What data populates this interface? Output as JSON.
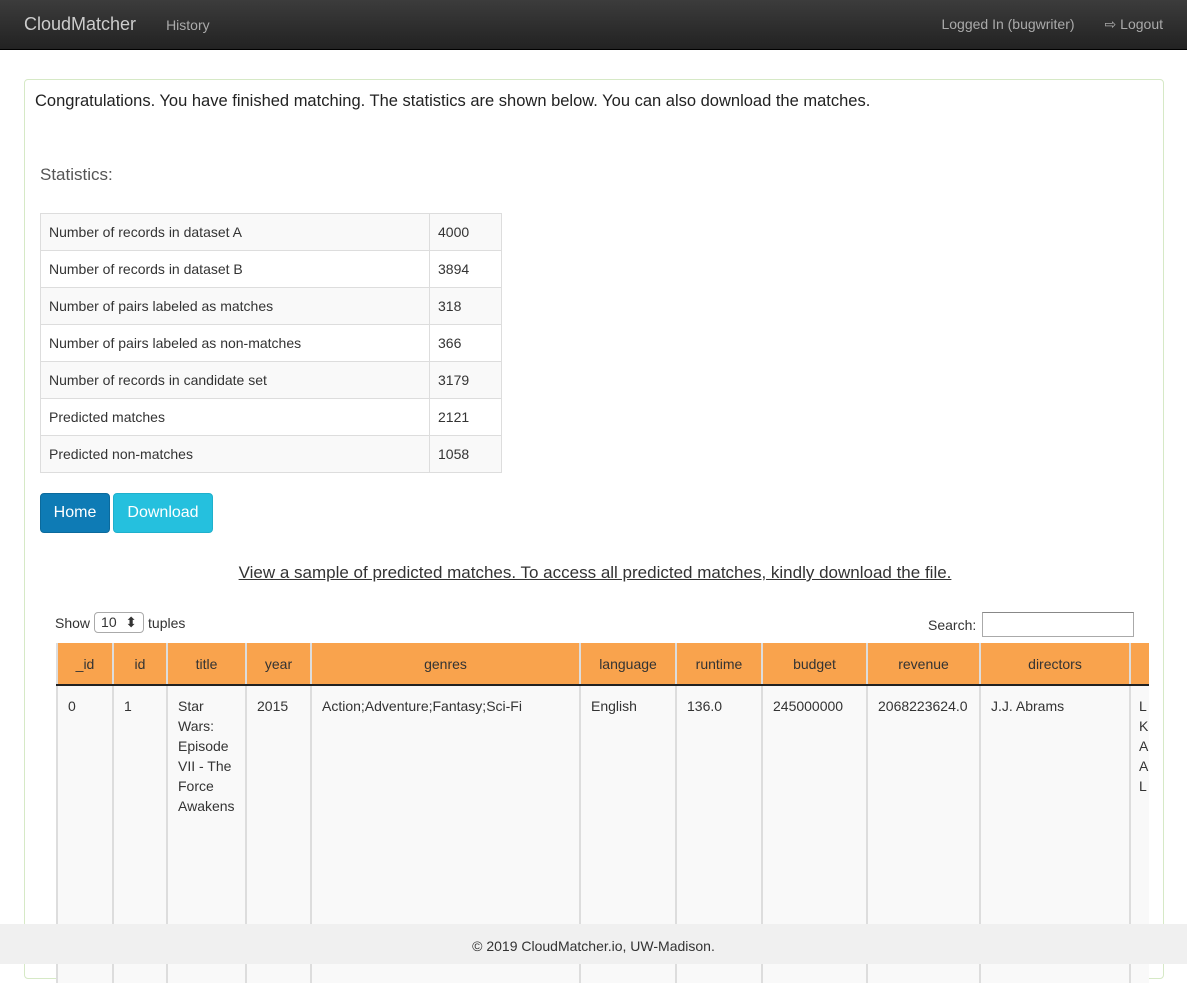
{
  "nav": {
    "brand": "CloudMatcher",
    "history": "History",
    "logged_in": "Logged In (bugwriter)",
    "logout": "Logout"
  },
  "message": "Congratulations. You have finished matching. The statistics are shown below. You can also download the matches.",
  "stats_title": "Statistics:",
  "stats": [
    {
      "label": "Number of records in dataset A",
      "value": "4000"
    },
    {
      "label": "Number of records in dataset B",
      "value": "3894"
    },
    {
      "label": "Number of pairs labeled as matches",
      "value": "318"
    },
    {
      "label": "Number of pairs labeled as non-matches",
      "value": "366"
    },
    {
      "label": "Number of records in candidate set",
      "value": "3179"
    },
    {
      "label": "Predicted matches",
      "value": "2121"
    },
    {
      "label": "Predicted non-matches",
      "value": "1058"
    }
  ],
  "buttons": {
    "home": "Home",
    "download": "Download"
  },
  "sample_link": "View a sample of predicted matches. To access all predicted matches, kindly download the file.",
  "table": {
    "show_label": "Show",
    "show_value": "10",
    "show_suffix": "tuples",
    "search_label": "Search:",
    "search_value": "",
    "header_color": "#f9a34d",
    "columns": [
      "_id",
      "id",
      "title",
      "year",
      "genres",
      "language",
      "runtime",
      "budget",
      "revenue",
      "directors",
      ""
    ],
    "rows": [
      [
        "0",
        "1",
        "Star Wars: Episode VII - The Force Awakens",
        "2015",
        "Action;Adventure;Fantasy;Sci-Fi",
        "English",
        "136.0",
        "245000000",
        "2068223624.0",
        "J.J. Abrams",
        "L K A A L"
      ]
    ]
  },
  "footer": "© 2019 CloudMatcher.io, UW-Madison."
}
